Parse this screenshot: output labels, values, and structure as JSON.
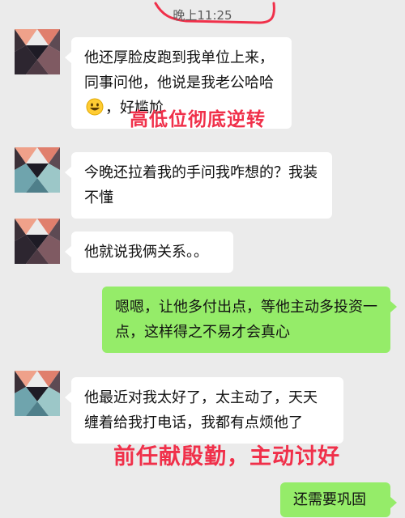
{
  "timestamp": "晚上11:25",
  "messages": [
    {
      "side": "left",
      "text": "他还厚脸皮跑到我单位上来，同事问他，他说是我老公哈哈",
      "text_after_emoji": "，好尴尬",
      "emoji": "grinning-face-icon"
    },
    {
      "side": "left",
      "text": "今晚还拉着我的手问我咋想的？我装不懂"
    },
    {
      "side": "left",
      "text": "他就说我俩关系。。"
    },
    {
      "side": "right",
      "text": "嗯嗯，让他多付出点，等他主动多投资一点，这样得之不易才会真心"
    },
    {
      "side": "left",
      "text": "他最近对我太好了，太主动了，天天缠着给我打电话，我都有点烦他了"
    },
    {
      "side": "right",
      "text": "还需要巩固"
    }
  ],
  "overlays": {
    "annotation_1": "高低位彻底逆转",
    "annotation_2": "前任献殷勤，主动讨好"
  },
  "colors": {
    "background": "#ebebeb",
    "bubble_left": "#ffffff",
    "bubble_right": "#95ec69",
    "overlay_text": "#f0304a"
  }
}
